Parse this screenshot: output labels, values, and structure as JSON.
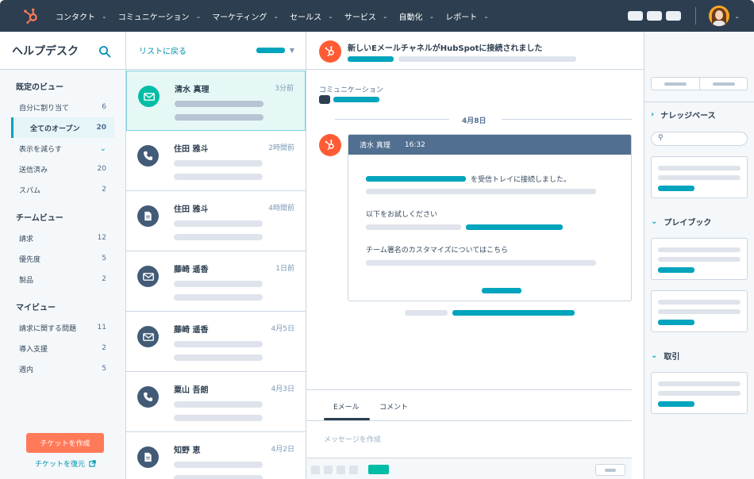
{
  "topnav": {
    "items": [
      {
        "label": "コンタクト"
      },
      {
        "label": "コミュニケーション"
      },
      {
        "label": "マーケティング"
      },
      {
        "label": "セールス"
      },
      {
        "label": "サービス"
      },
      {
        "label": "自動化"
      },
      {
        "label": "レポート"
      }
    ]
  },
  "sidebar": {
    "title": "ヘルプデスク",
    "sections": [
      {
        "title": "既定のビュー",
        "items": [
          {
            "label": "自分に割り当て",
            "count": "6"
          },
          {
            "label": "全てのオープン",
            "count": "20"
          },
          {
            "label": "表示を減らす",
            "count": ""
          },
          {
            "label": "送信済み",
            "count": "20"
          },
          {
            "label": "スパム",
            "count": "2"
          }
        ]
      },
      {
        "title": "チームビュー",
        "items": [
          {
            "label": "請求",
            "count": "12"
          },
          {
            "label": "優先度",
            "count": "5"
          },
          {
            "label": "製品",
            "count": "2"
          }
        ]
      },
      {
        "title": "マイビュー",
        "items": [
          {
            "label": "請求に関する問題",
            "count": "11"
          },
          {
            "label": "導入支援",
            "count": "2"
          },
          {
            "label": "週内",
            "count": "5"
          }
        ]
      }
    ],
    "create_button": "チケットを作成",
    "restore_link": "チケットを復元"
  },
  "list": {
    "back_label": "リストに戻る",
    "tickets": [
      {
        "name": "清水 真理",
        "time": "3分前",
        "icon": "email-icon"
      },
      {
        "name": "住田 雅斗",
        "time": "2時間前",
        "icon": "phone-icon"
      },
      {
        "name": "住田 雅斗",
        "time": "4時間前",
        "icon": "document-icon"
      },
      {
        "name": "藤崎 遥香",
        "time": "1日前",
        "icon": "email-icon"
      },
      {
        "name": "藤崎 遥香",
        "time": "4月5日",
        "icon": "email-icon"
      },
      {
        "name": "粟山 吾朗",
        "time": "4月3日",
        "icon": "phone-icon"
      },
      {
        "name": "知野 恵",
        "time": "4月2日",
        "icon": "document-icon"
      }
    ]
  },
  "conversation": {
    "title": "新しいEメールチャネルがHubSpotに接続されました",
    "channel_label": "コミュニケーション",
    "date": "4月8日",
    "message": {
      "sender": "清水 真理",
      "time": "16:32",
      "line1_suffix": "を受信トレイに接続しました。",
      "line2": "以下をお試しください",
      "line3": "チーム署名のカスタマイズについてはこちら"
    },
    "composer": {
      "tabs": [
        {
          "label": "Eメール"
        },
        {
          "label": "コメント"
        }
      ],
      "placeholder": "メッセージを作成"
    }
  },
  "right_panel": {
    "sections": [
      {
        "title": "ナレッジベース"
      },
      {
        "title": "プレイブック"
      },
      {
        "title": "取引"
      }
    ]
  },
  "colors": {
    "nav_bg": "#2d3e50",
    "accent_teal": "#00a4bd",
    "accent_orange": "#ff7a59",
    "hubspot_orange": "#ff5c35",
    "selected_bg": "#e5f8f6"
  }
}
